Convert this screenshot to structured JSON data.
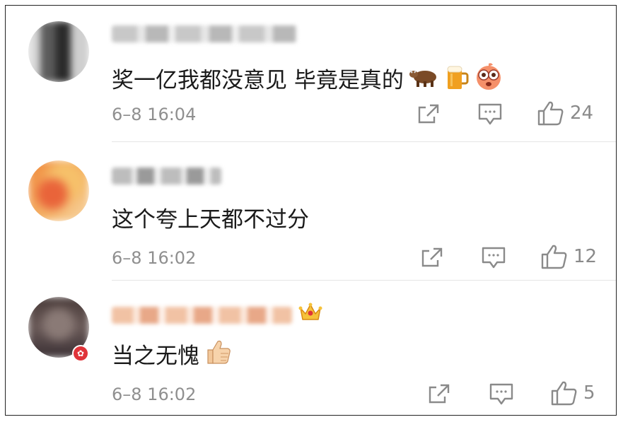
{
  "comments": [
    {
      "text": "奖一亿我都没意见 毕竟是真的",
      "emojis": [
        "cow-emoji",
        "beer-emoji",
        "surprised-face-emoji"
      ],
      "timestamp": "6–8 16:04",
      "likes": "24",
      "avatar_colors": [
        "#6b6b6b",
        "#2b2b2b",
        "#bdbdbd"
      ]
    },
    {
      "text": "这个夸上天都不过分",
      "emojis": [],
      "timestamp": "6–8 16:02",
      "likes": "12",
      "avatar_colors": [
        "#f08a3c",
        "#f6c16a",
        "#e9643a"
      ]
    },
    {
      "text": "当之无愧",
      "emojis": [
        "thumbs-up-emoji"
      ],
      "timestamp": "6–8 16:02",
      "likes": "5",
      "avatar_colors": [
        "#5a4a48",
        "#8a7a76",
        "#3a3034"
      ],
      "verified_badge": true,
      "vip_crown": true
    }
  ],
  "colors": {
    "text": "#1a1a1a",
    "meta": "#8f8f8f",
    "divider": "#e6e6e6",
    "badge": "#e0343a"
  }
}
